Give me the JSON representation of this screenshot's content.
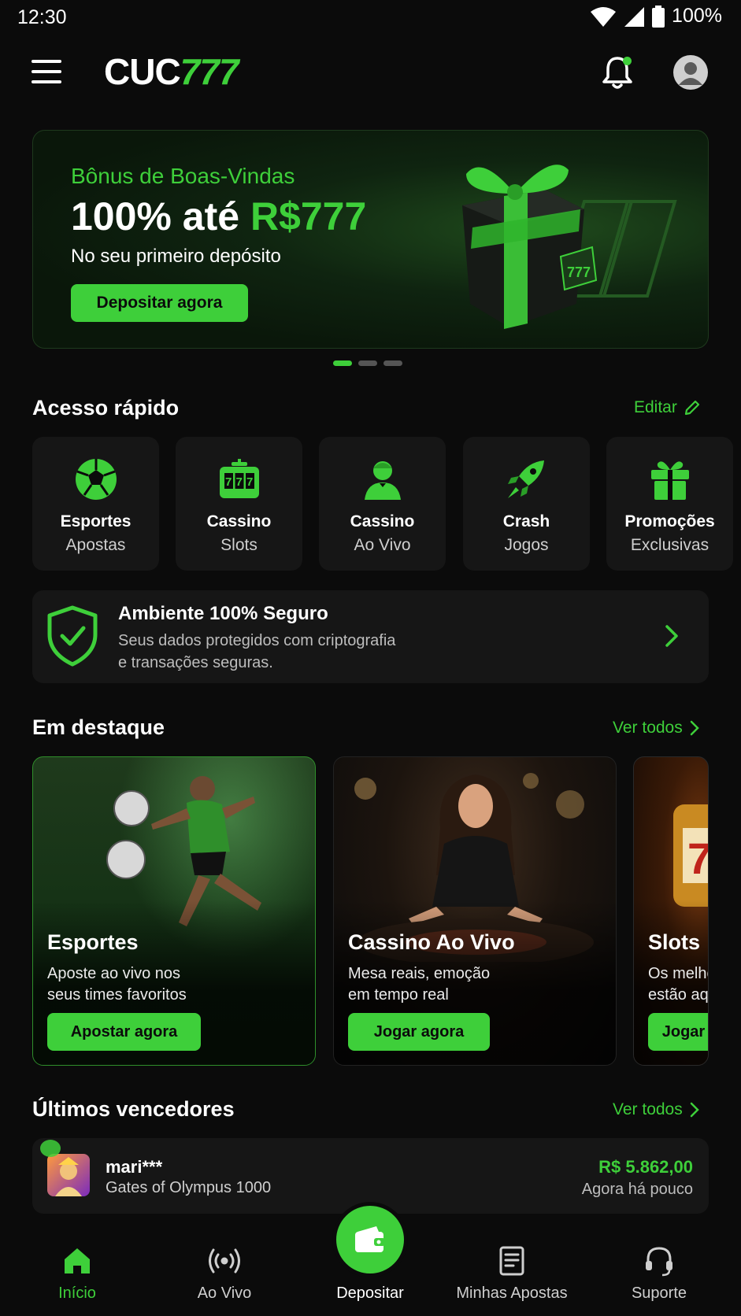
{
  "status_bar": {
    "time": "12:30",
    "battery": "100%"
  },
  "header": {
    "logo_white": "CUC",
    "logo_green": "777",
    "icons": [
      "menu-icon",
      "bell-icon",
      "user-icon"
    ]
  },
  "banner": {
    "subtitle": "Bônus de Boas-Vindas",
    "title_prefix": "100% até ",
    "title_highlight": "R$777",
    "description": "No seu primeiro depósito",
    "button": "Depositar agora",
    "gift_text": "777",
    "carousel": {
      "count": 3,
      "active_index": 0
    }
  },
  "quick_access": {
    "title": "Acesso rápido",
    "edit": "Editar",
    "items": [
      {
        "line1": "Esportes",
        "line2": "Apostas",
        "icon": "soccer-ball-icon"
      },
      {
        "line1": "Cassino",
        "line2": "Slots",
        "icon": "slot-machine-icon"
      },
      {
        "line1": "Cassino",
        "line2": "Ao Vivo",
        "icon": "dealer-icon"
      },
      {
        "line1": "Crash",
        "line2": "Jogos",
        "icon": "rocket-icon"
      },
      {
        "line1": "Promoções",
        "line2": "Exclusivas",
        "icon": "gift-icon"
      }
    ]
  },
  "security": {
    "title": "Ambiente 100% Seguro",
    "description_line1": "Seus dados protegidos com criptografia",
    "description_line2": "e transações seguras."
  },
  "featured": {
    "title": "Em destaque",
    "see_all": "Ver todos",
    "cards": [
      {
        "title": "Esportes",
        "desc_line1": "Aposte ao vivo nos",
        "desc_line2": "seus times favoritos",
        "button": "Apostar agora"
      },
      {
        "title": "Cassino Ao Vivo",
        "desc_line1": "Mesa reais, emoção",
        "desc_line2": "em tempo real",
        "button": "Jogar agora"
      },
      {
        "title": "Slots",
        "desc_line1": "Os melhores",
        "desc_line2": "estão aqui",
        "button": "Jogar agora"
      }
    ]
  },
  "winners": {
    "title": "Últimos vencedores",
    "see_all": "Ver todos",
    "items": [
      {
        "name": "mari***",
        "game": "Gates of Olympus 1000",
        "amount": "R$ 5.862,00",
        "time": "Agora há pouco"
      }
    ]
  },
  "bottom_nav": {
    "items": [
      {
        "label": "Início",
        "icon": "home-icon",
        "active": true
      },
      {
        "label": "Ao Vivo",
        "icon": "live-broadcast-icon",
        "active": false
      },
      {
        "label": "Depositar",
        "icon": "wallet-icon",
        "active": false
      },
      {
        "label": "Minhas Apostas",
        "icon": "bets-list-icon",
        "active": false
      },
      {
        "label": "Suporte",
        "icon": "headset-icon",
        "active": false
      }
    ]
  },
  "colors": {
    "accent": "#3ecf3a",
    "background": "#0b0b0b",
    "card": "#161616"
  }
}
